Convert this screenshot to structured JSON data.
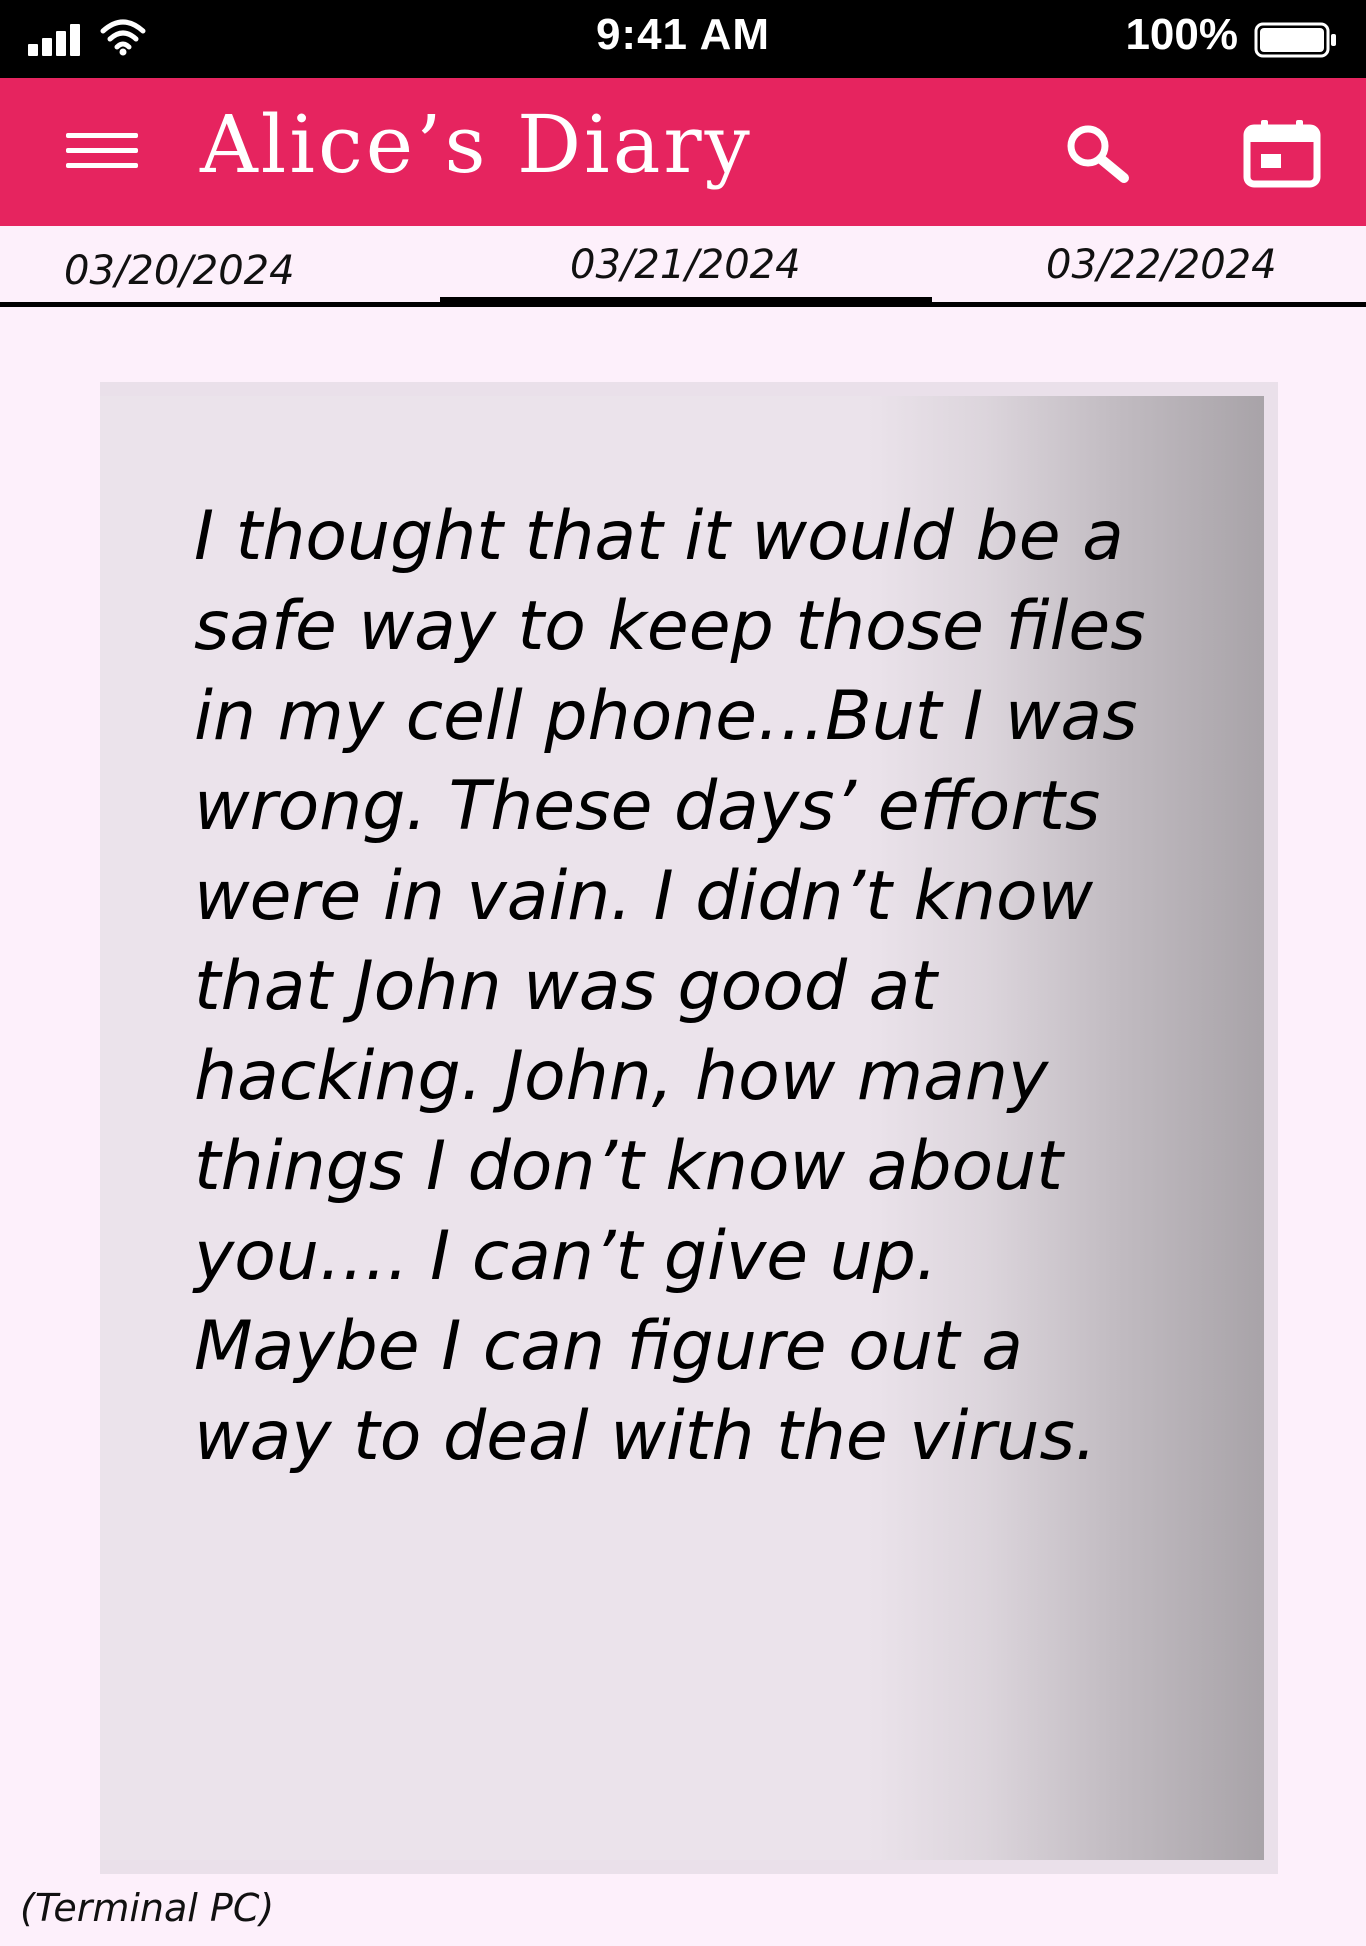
{
  "status_bar": {
    "time": "9:41 AM",
    "battery_percent": "100%",
    "icons": [
      "signal-icon",
      "wifi-icon",
      "battery-icon"
    ]
  },
  "app_bar": {
    "title": "Alice’s Diary",
    "background_color": "#e6245f",
    "icons": [
      "menu-icon",
      "search-icon",
      "calendar-icon"
    ]
  },
  "date_tabs": [
    {
      "label": "03/20/2024",
      "selected": false
    },
    {
      "label": "03/21/2024",
      "selected": true
    },
    {
      "label": "03/22/2024",
      "selected": false
    }
  ],
  "entry": {
    "lines": [
      "I thought that it would be a",
      "safe way to keep those files",
      "in my cell phone…But I was",
      "wrong. These days’ efforts",
      "were in vain. I didn’t know",
      "that John was good at",
      "hacking. John, how many",
      "things I don’t know about",
      "you…. I can’t give up.",
      "Maybe I can figure out a",
      "way to deal with the virus."
    ]
  },
  "caption": "(Terminal PC)"
}
